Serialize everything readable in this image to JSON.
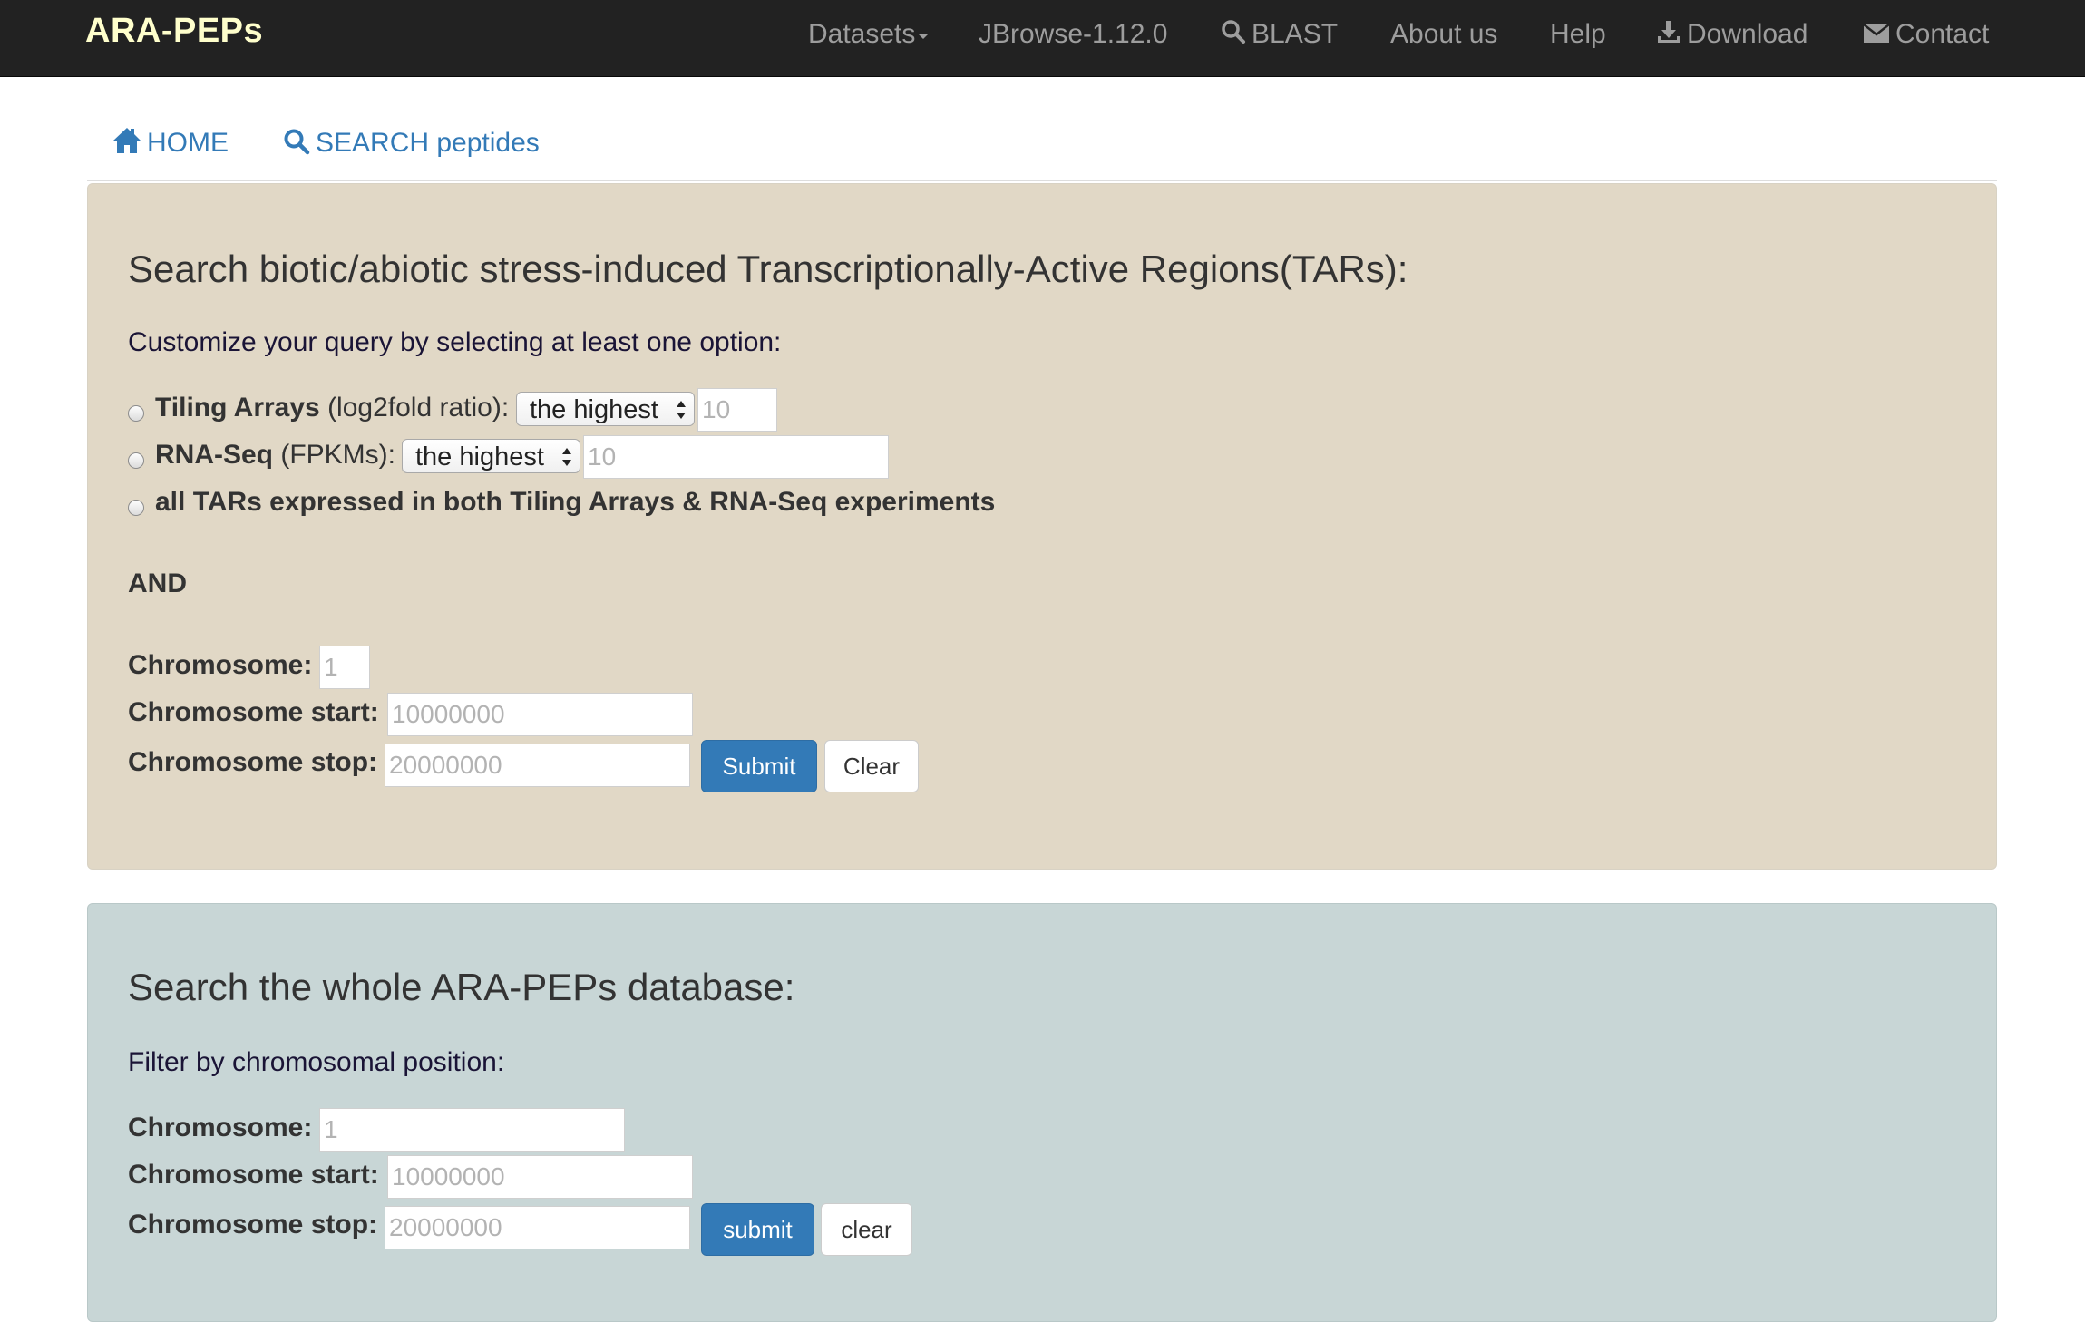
{
  "navbar": {
    "brand": "ARA-PEPs",
    "datasets": "Datasets",
    "jbrowse": "JBrowse-1.12.0",
    "blast": "BLAST",
    "about": "About us",
    "help": "Help",
    "download": "Download",
    "contact": "Contact"
  },
  "subnav": {
    "home": "HOME",
    "search": "SEARCH peptides"
  },
  "tars_panel": {
    "title": "Search biotic/abiotic stress-induced Transcriptionally-Active Regions(TARs):",
    "subtitle": "Customize your query by selecting at least one option:",
    "tiling": {
      "label_bold": "Tiling Arrays",
      "label_rest": " (log2fold ratio):",
      "select_value": "the highest",
      "input_placeholder": "10"
    },
    "rnaseq": {
      "label_bold": "RNA-Seq",
      "label_rest": " (FPKMs):",
      "select_value": "the highest",
      "input_placeholder": "10"
    },
    "both_label": "all TARs expressed in both Tiling Arrays & RNA-Seq experiments",
    "and_label": "AND",
    "chromosome_label": "Chromosome:",
    "chromosome_placeholder": "1",
    "start_label": "Chromosome start:",
    "start_placeholder": "10000000",
    "stop_label": "Chromosome stop:",
    "stop_placeholder": "20000000",
    "submit": "Submit",
    "clear": "Clear"
  },
  "db_panel": {
    "title": "Search the whole ARA-PEPs database:",
    "subtitle": "Filter by chromosomal position:",
    "chromosome_label": "Chromosome:",
    "chromosome_placeholder": "1",
    "start_label": "Chromosome start:",
    "start_placeholder": "10000000",
    "stop_label": "Chromosome stop:",
    "stop_placeholder": "20000000",
    "submit": "submit",
    "clear": "clear"
  },
  "colors": {
    "navbar_bg": "#222222",
    "brand": "#ffffcc",
    "nav_text": "#9d9d9d",
    "link": "#337ab7",
    "tars_panel_bg": "#e1d8c6",
    "db_panel_bg": "#c8d6d6",
    "primary_button": "#337ab7"
  }
}
